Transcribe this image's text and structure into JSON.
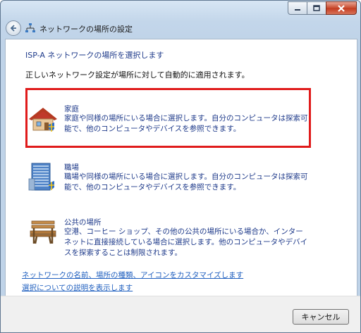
{
  "window": {
    "title": "ネットワークの場所の設定",
    "controls": {
      "minimize": "minimize-icon",
      "maximize": "maximize-icon",
      "close": "close-icon"
    }
  },
  "nav": {
    "back_icon": "back-arrow-icon",
    "network_icon": "network-icon"
  },
  "content": {
    "heading": "ISP-A ネットワークの場所を選択します",
    "instruction": "正しいネットワーク設定が場所に対して自動的に適用されます。",
    "options": [
      {
        "title": "家庭",
        "description": "家庭や同様の場所にいる場合に選択します。自分のコンピュータは探索可能で、他のコンピュータやデバイスを参照できます。",
        "icon": "house-icon"
      },
      {
        "title": "職場",
        "description": "職場や同様の場所にいる場合に選択します。自分のコンピュータは探索可能で、他のコンピュータやデバイスを参照できます。",
        "icon": "office-building-icon"
      },
      {
        "title": "公共の場所",
        "description": "空港、コーヒー ショップ、その他の公共の場所にいる場合か、インターネットに直接接続している場合に選択します。他のコンピュータやデバイスを探索することは制限されます。",
        "icon": "park-bench-icon"
      }
    ],
    "links": [
      "ネットワークの名前、場所の種類、アイコンをカスタマイズします",
      "選択についての説明を表示します"
    ]
  },
  "footer": {
    "cancel_label": "キャンセル"
  },
  "colors": {
    "highlight": "#e01b1b",
    "link": "#1f5fbf",
    "heading": "#1e3a8a"
  }
}
